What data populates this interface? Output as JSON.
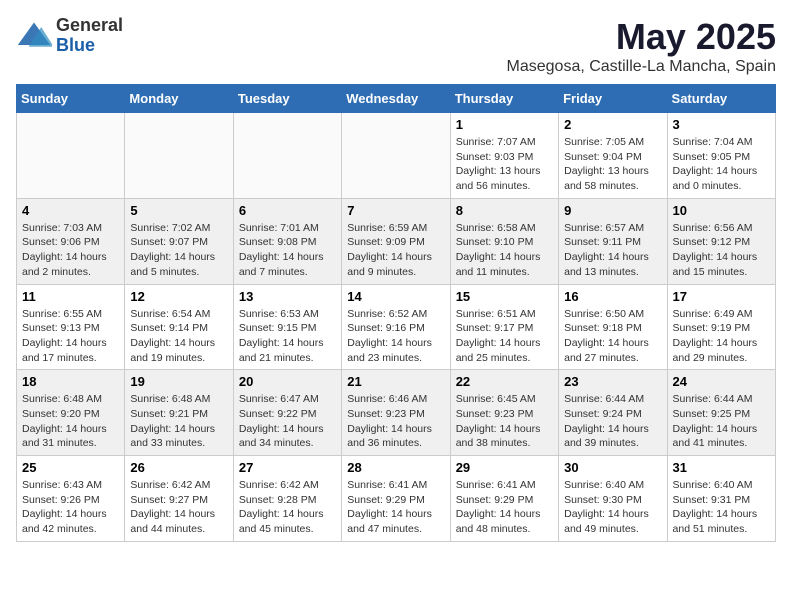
{
  "header": {
    "logo_general": "General",
    "logo_blue": "Blue",
    "title": "May 2025",
    "subtitle": "Masegosa, Castille-La Mancha, Spain"
  },
  "days_of_week": [
    "Sunday",
    "Monday",
    "Tuesday",
    "Wednesday",
    "Thursday",
    "Friday",
    "Saturday"
  ],
  "weeks": [
    [
      {
        "day": "",
        "info": ""
      },
      {
        "day": "",
        "info": ""
      },
      {
        "day": "",
        "info": ""
      },
      {
        "day": "",
        "info": ""
      },
      {
        "day": "1",
        "info": "Sunrise: 7:07 AM\nSunset: 9:03 PM\nDaylight: 13 hours\nand 56 minutes."
      },
      {
        "day": "2",
        "info": "Sunrise: 7:05 AM\nSunset: 9:04 PM\nDaylight: 13 hours\nand 58 minutes."
      },
      {
        "day": "3",
        "info": "Sunrise: 7:04 AM\nSunset: 9:05 PM\nDaylight: 14 hours\nand 0 minutes."
      }
    ],
    [
      {
        "day": "4",
        "info": "Sunrise: 7:03 AM\nSunset: 9:06 PM\nDaylight: 14 hours\nand 2 minutes."
      },
      {
        "day": "5",
        "info": "Sunrise: 7:02 AM\nSunset: 9:07 PM\nDaylight: 14 hours\nand 5 minutes."
      },
      {
        "day": "6",
        "info": "Sunrise: 7:01 AM\nSunset: 9:08 PM\nDaylight: 14 hours\nand 7 minutes."
      },
      {
        "day": "7",
        "info": "Sunrise: 6:59 AM\nSunset: 9:09 PM\nDaylight: 14 hours\nand 9 minutes."
      },
      {
        "day": "8",
        "info": "Sunrise: 6:58 AM\nSunset: 9:10 PM\nDaylight: 14 hours\nand 11 minutes."
      },
      {
        "day": "9",
        "info": "Sunrise: 6:57 AM\nSunset: 9:11 PM\nDaylight: 14 hours\nand 13 minutes."
      },
      {
        "day": "10",
        "info": "Sunrise: 6:56 AM\nSunset: 9:12 PM\nDaylight: 14 hours\nand 15 minutes."
      }
    ],
    [
      {
        "day": "11",
        "info": "Sunrise: 6:55 AM\nSunset: 9:13 PM\nDaylight: 14 hours\nand 17 minutes."
      },
      {
        "day": "12",
        "info": "Sunrise: 6:54 AM\nSunset: 9:14 PM\nDaylight: 14 hours\nand 19 minutes."
      },
      {
        "day": "13",
        "info": "Sunrise: 6:53 AM\nSunset: 9:15 PM\nDaylight: 14 hours\nand 21 minutes."
      },
      {
        "day": "14",
        "info": "Sunrise: 6:52 AM\nSunset: 9:16 PM\nDaylight: 14 hours\nand 23 minutes."
      },
      {
        "day": "15",
        "info": "Sunrise: 6:51 AM\nSunset: 9:17 PM\nDaylight: 14 hours\nand 25 minutes."
      },
      {
        "day": "16",
        "info": "Sunrise: 6:50 AM\nSunset: 9:18 PM\nDaylight: 14 hours\nand 27 minutes."
      },
      {
        "day": "17",
        "info": "Sunrise: 6:49 AM\nSunset: 9:19 PM\nDaylight: 14 hours\nand 29 minutes."
      }
    ],
    [
      {
        "day": "18",
        "info": "Sunrise: 6:48 AM\nSunset: 9:20 PM\nDaylight: 14 hours\nand 31 minutes."
      },
      {
        "day": "19",
        "info": "Sunrise: 6:48 AM\nSunset: 9:21 PM\nDaylight: 14 hours\nand 33 minutes."
      },
      {
        "day": "20",
        "info": "Sunrise: 6:47 AM\nSunset: 9:22 PM\nDaylight: 14 hours\nand 34 minutes."
      },
      {
        "day": "21",
        "info": "Sunrise: 6:46 AM\nSunset: 9:23 PM\nDaylight: 14 hours\nand 36 minutes."
      },
      {
        "day": "22",
        "info": "Sunrise: 6:45 AM\nSunset: 9:23 PM\nDaylight: 14 hours\nand 38 minutes."
      },
      {
        "day": "23",
        "info": "Sunrise: 6:44 AM\nSunset: 9:24 PM\nDaylight: 14 hours\nand 39 minutes."
      },
      {
        "day": "24",
        "info": "Sunrise: 6:44 AM\nSunset: 9:25 PM\nDaylight: 14 hours\nand 41 minutes."
      }
    ],
    [
      {
        "day": "25",
        "info": "Sunrise: 6:43 AM\nSunset: 9:26 PM\nDaylight: 14 hours\nand 42 minutes."
      },
      {
        "day": "26",
        "info": "Sunrise: 6:42 AM\nSunset: 9:27 PM\nDaylight: 14 hours\nand 44 minutes."
      },
      {
        "day": "27",
        "info": "Sunrise: 6:42 AM\nSunset: 9:28 PM\nDaylight: 14 hours\nand 45 minutes."
      },
      {
        "day": "28",
        "info": "Sunrise: 6:41 AM\nSunset: 9:29 PM\nDaylight: 14 hours\nand 47 minutes."
      },
      {
        "day": "29",
        "info": "Sunrise: 6:41 AM\nSunset: 9:29 PM\nDaylight: 14 hours\nand 48 minutes."
      },
      {
        "day": "30",
        "info": "Sunrise: 6:40 AM\nSunset: 9:30 PM\nDaylight: 14 hours\nand 49 minutes."
      },
      {
        "day": "31",
        "info": "Sunrise: 6:40 AM\nSunset: 9:31 PM\nDaylight: 14 hours\nand 51 minutes."
      }
    ]
  ]
}
